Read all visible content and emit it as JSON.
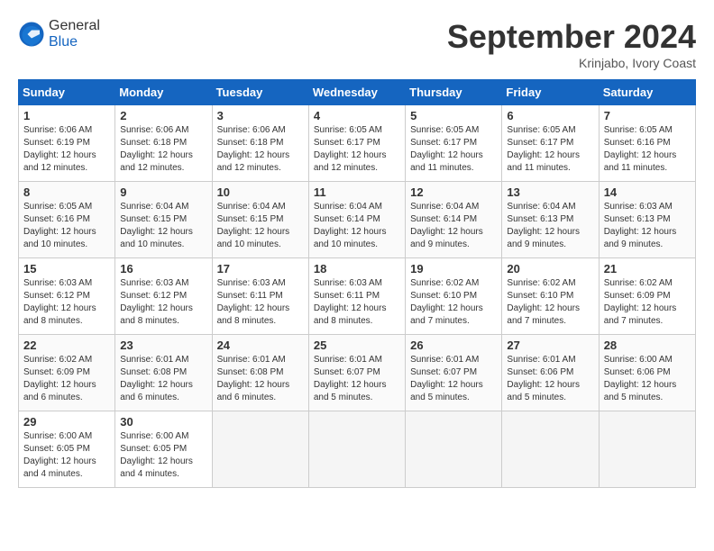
{
  "header": {
    "logo_line1": "General",
    "logo_line2": "Blue",
    "month": "September 2024",
    "location": "Krinjabo, Ivory Coast"
  },
  "weekdays": [
    "Sunday",
    "Monday",
    "Tuesday",
    "Wednesday",
    "Thursday",
    "Friday",
    "Saturday"
  ],
  "weeks": [
    [
      {
        "day": 1,
        "info": "Sunrise: 6:06 AM\nSunset: 6:19 PM\nDaylight: 12 hours\nand 12 minutes."
      },
      {
        "day": 2,
        "info": "Sunrise: 6:06 AM\nSunset: 6:18 PM\nDaylight: 12 hours\nand 12 minutes."
      },
      {
        "day": 3,
        "info": "Sunrise: 6:06 AM\nSunset: 6:18 PM\nDaylight: 12 hours\nand 12 minutes."
      },
      {
        "day": 4,
        "info": "Sunrise: 6:05 AM\nSunset: 6:17 PM\nDaylight: 12 hours\nand 12 minutes."
      },
      {
        "day": 5,
        "info": "Sunrise: 6:05 AM\nSunset: 6:17 PM\nDaylight: 12 hours\nand 11 minutes."
      },
      {
        "day": 6,
        "info": "Sunrise: 6:05 AM\nSunset: 6:17 PM\nDaylight: 12 hours\nand 11 minutes."
      },
      {
        "day": 7,
        "info": "Sunrise: 6:05 AM\nSunset: 6:16 PM\nDaylight: 12 hours\nand 11 minutes."
      }
    ],
    [
      {
        "day": 8,
        "info": "Sunrise: 6:05 AM\nSunset: 6:16 PM\nDaylight: 12 hours\nand 10 minutes."
      },
      {
        "day": 9,
        "info": "Sunrise: 6:04 AM\nSunset: 6:15 PM\nDaylight: 12 hours\nand 10 minutes."
      },
      {
        "day": 10,
        "info": "Sunrise: 6:04 AM\nSunset: 6:15 PM\nDaylight: 12 hours\nand 10 minutes."
      },
      {
        "day": 11,
        "info": "Sunrise: 6:04 AM\nSunset: 6:14 PM\nDaylight: 12 hours\nand 10 minutes."
      },
      {
        "day": 12,
        "info": "Sunrise: 6:04 AM\nSunset: 6:14 PM\nDaylight: 12 hours\nand 9 minutes."
      },
      {
        "day": 13,
        "info": "Sunrise: 6:04 AM\nSunset: 6:13 PM\nDaylight: 12 hours\nand 9 minutes."
      },
      {
        "day": 14,
        "info": "Sunrise: 6:03 AM\nSunset: 6:13 PM\nDaylight: 12 hours\nand 9 minutes."
      }
    ],
    [
      {
        "day": 15,
        "info": "Sunrise: 6:03 AM\nSunset: 6:12 PM\nDaylight: 12 hours\nand 8 minutes."
      },
      {
        "day": 16,
        "info": "Sunrise: 6:03 AM\nSunset: 6:12 PM\nDaylight: 12 hours\nand 8 minutes."
      },
      {
        "day": 17,
        "info": "Sunrise: 6:03 AM\nSunset: 6:11 PM\nDaylight: 12 hours\nand 8 minutes."
      },
      {
        "day": 18,
        "info": "Sunrise: 6:03 AM\nSunset: 6:11 PM\nDaylight: 12 hours\nand 8 minutes."
      },
      {
        "day": 19,
        "info": "Sunrise: 6:02 AM\nSunset: 6:10 PM\nDaylight: 12 hours\nand 7 minutes."
      },
      {
        "day": 20,
        "info": "Sunrise: 6:02 AM\nSunset: 6:10 PM\nDaylight: 12 hours\nand 7 minutes."
      },
      {
        "day": 21,
        "info": "Sunrise: 6:02 AM\nSunset: 6:09 PM\nDaylight: 12 hours\nand 7 minutes."
      }
    ],
    [
      {
        "day": 22,
        "info": "Sunrise: 6:02 AM\nSunset: 6:09 PM\nDaylight: 12 hours\nand 6 minutes."
      },
      {
        "day": 23,
        "info": "Sunrise: 6:01 AM\nSunset: 6:08 PM\nDaylight: 12 hours\nand 6 minutes."
      },
      {
        "day": 24,
        "info": "Sunrise: 6:01 AM\nSunset: 6:08 PM\nDaylight: 12 hours\nand 6 minutes."
      },
      {
        "day": 25,
        "info": "Sunrise: 6:01 AM\nSunset: 6:07 PM\nDaylight: 12 hours\nand 5 minutes."
      },
      {
        "day": 26,
        "info": "Sunrise: 6:01 AM\nSunset: 6:07 PM\nDaylight: 12 hours\nand 5 minutes."
      },
      {
        "day": 27,
        "info": "Sunrise: 6:01 AM\nSunset: 6:06 PM\nDaylight: 12 hours\nand 5 minutes."
      },
      {
        "day": 28,
        "info": "Sunrise: 6:00 AM\nSunset: 6:06 PM\nDaylight: 12 hours\nand 5 minutes."
      }
    ],
    [
      {
        "day": 29,
        "info": "Sunrise: 6:00 AM\nSunset: 6:05 PM\nDaylight: 12 hours\nand 4 minutes."
      },
      {
        "day": 30,
        "info": "Sunrise: 6:00 AM\nSunset: 6:05 PM\nDaylight: 12 hours\nand 4 minutes."
      },
      null,
      null,
      null,
      null,
      null
    ]
  ]
}
